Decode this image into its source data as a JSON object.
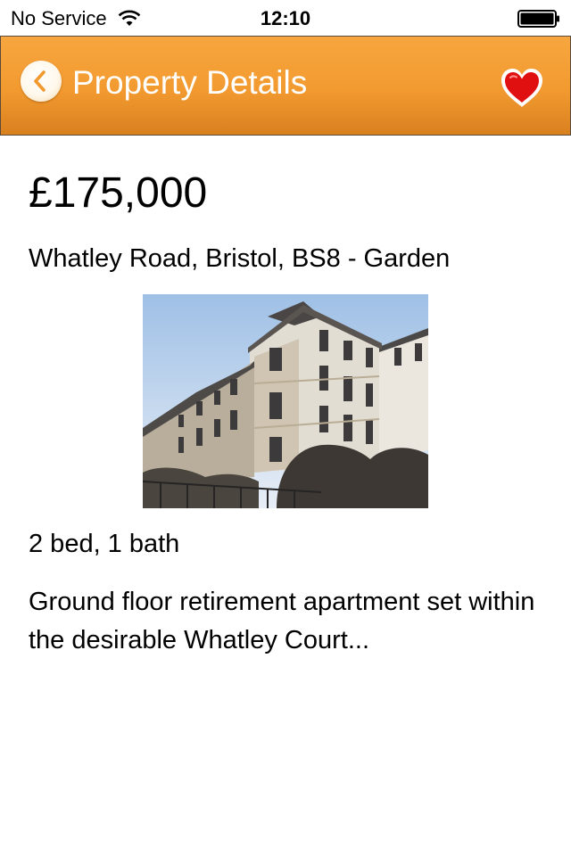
{
  "status_bar": {
    "carrier": "No Service",
    "time": "12:10",
    "icons": [
      "wifi-icon",
      "battery-icon"
    ]
  },
  "nav_bar": {
    "title": "Property Details",
    "back_icon": "chevron-left-icon",
    "favorite_icon": "heart-icon",
    "accent_color": "#f29a30",
    "favorite_color": "#e01010"
  },
  "property": {
    "price": "£175,000",
    "address": "Whatley Road, Bristol, BS8 - Garden",
    "photo": "building-photo",
    "specs": "2 bed, 1 bath",
    "description": "Ground floor retirement apartment set within the desirable Whatley Court..."
  }
}
